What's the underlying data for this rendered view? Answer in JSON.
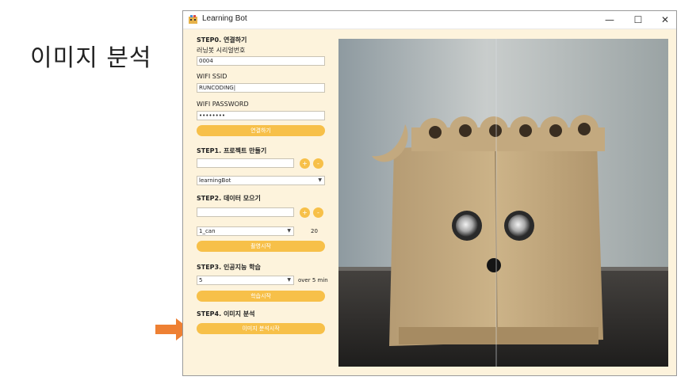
{
  "page": {
    "heading": "이미지 분석"
  },
  "window": {
    "title": "Learning Bot",
    "controls": {
      "minimize": "—",
      "maximize": "☐",
      "close": "✕"
    }
  },
  "step0": {
    "title": "STEP0. 연결하기",
    "serial_label": "러닝봇 시리얼번호",
    "serial_value": "0004",
    "ssid_label": "WIFI SSID",
    "ssid_value": "RUNCODING|",
    "password_label": "WIFI PASSWORD",
    "password_value": "••••••••",
    "connect_button": "연결하기"
  },
  "step1": {
    "title": "STEP1. 프로젝트 만들기",
    "project_value": "",
    "add_button": "+",
    "remove_button": "-",
    "selected_project": "learningBot"
  },
  "step2": {
    "title": "STEP2. 데이터 모으기",
    "label_value": "",
    "add_button": "+",
    "remove_button": "-",
    "selected_label": "1_can",
    "count": "20",
    "capture_button": "촬영시작"
  },
  "step3": {
    "title": "STEP3. 인공지능 학습",
    "selected_epochs": "5",
    "duration_note": "over 5 min",
    "train_button": "학습시작"
  },
  "step4": {
    "title": "STEP4. 이미지 분석",
    "analyze_button": "이미지 분석시작"
  },
  "icons": {
    "app": "app-icon",
    "arrow": "arrow-right-icon",
    "dropdown": "chevron-down-icon"
  },
  "colors": {
    "panel_bg": "#fdf3dc",
    "accent": "#f7c049",
    "arrow": "#ee8033"
  }
}
